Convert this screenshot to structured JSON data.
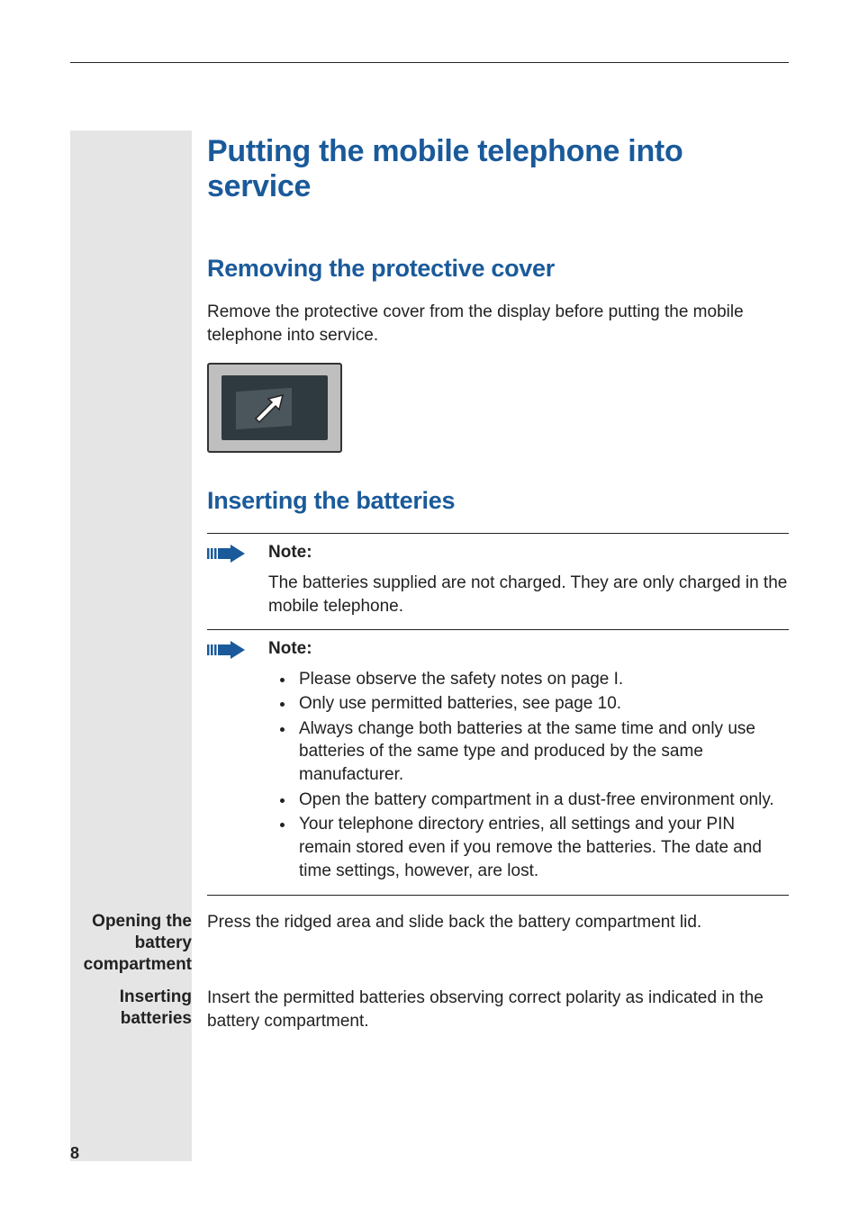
{
  "page_number": "8",
  "title": "Putting the mobile telephone into service",
  "sections": {
    "removing": {
      "heading": "Removing the protective cover",
      "body": "Remove the protective cover from the display before putting the mobile telephone into service."
    },
    "inserting": {
      "heading": "Inserting the batteries",
      "note1": {
        "label": "Note:",
        "text": "The batteries supplied are not charged. They are only charged in the mobile telephone."
      },
      "note2": {
        "label": "Note:",
        "items": [
          "Please observe the safety notes on page I.",
          "Only use permitted batteries, see page 10.",
          "Always change both batteries at the same time and only use batteries of the same type and produced by the same manufacturer.",
          "Open the battery compartment in a dust-free environment only.",
          "Your telephone directory entries, all settings and your PIN remain stored even if you remove the batteries. The date and time settings, however, are lost."
        ]
      },
      "opening": {
        "label": "Opening the battery compartment",
        "body": "Press the ridged area and slide back the battery compartment lid."
      },
      "insert_batt": {
        "label": "Inserting batteries",
        "body": "Insert the permitted batteries observing correct polarity as indicated in the battery compartment."
      }
    }
  }
}
